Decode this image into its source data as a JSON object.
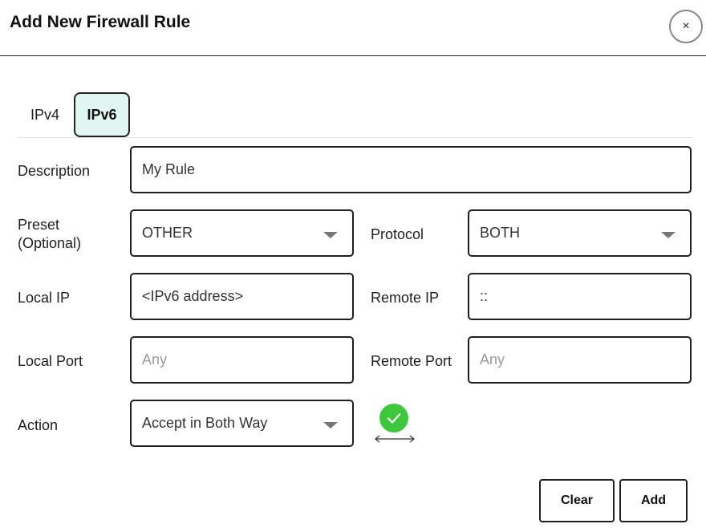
{
  "dialog": {
    "title": "Add New Firewall Rule",
    "close_label": "×"
  },
  "tabs": [
    {
      "label": "IPv4",
      "active": false
    },
    {
      "label": "IPv6",
      "active": true
    }
  ],
  "form": {
    "description": {
      "label": "Description",
      "value": "My Rule"
    },
    "preset": {
      "label_line1": "Preset",
      "label_line2": "(Optional)",
      "value": "OTHER"
    },
    "protocol": {
      "label": "Protocol",
      "value": "BOTH"
    },
    "local_ip": {
      "label": "Local IP",
      "value": "<IPv6 address>"
    },
    "remote_ip": {
      "label": "Remote IP",
      "value": "::"
    },
    "local_port": {
      "label": "Local Port",
      "placeholder": "Any"
    },
    "remote_port": {
      "label": "Remote Port",
      "placeholder": "Any"
    },
    "action": {
      "label": "Action",
      "value": "Accept in Both Way",
      "status_icon": "check-circle-icon",
      "direction_icon": "double-arrow-icon"
    }
  },
  "buttons": {
    "clear": "Clear",
    "add": "Add"
  },
  "colors": {
    "active_tab_bg": "#e0f7f1",
    "status_green": "#3cc73c"
  }
}
